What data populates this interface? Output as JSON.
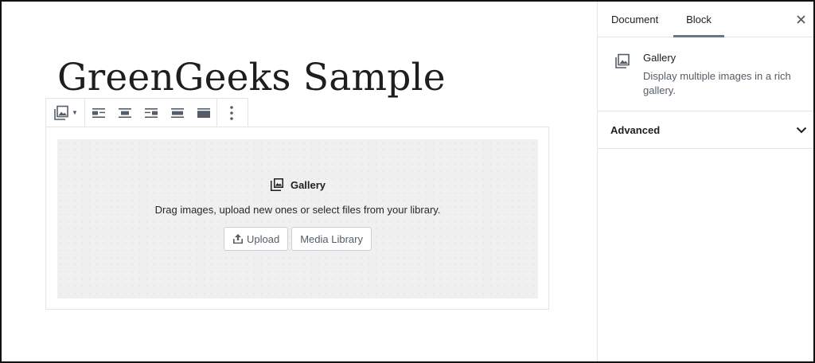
{
  "editor": {
    "post_title": "GreenGeeks Sample",
    "toolbar": {
      "block_type_icon": "gallery-icon",
      "alignments": [
        "align-left-icon",
        "align-center-icon",
        "align-right-icon",
        "align-wide-icon",
        "align-full-icon"
      ],
      "more_icon": "more-vertical-icon"
    },
    "gallery_placeholder": {
      "icon": "gallery-icon",
      "label": "Gallery",
      "instructions": "Drag images, upload new ones or select files from your library.",
      "upload_label": "Upload",
      "media_library_label": "Media Library"
    }
  },
  "sidebar": {
    "tabs": [
      {
        "label": "Document",
        "active": false
      },
      {
        "label": "Block",
        "active": true
      }
    ],
    "close_icon": "close-icon",
    "block_card": {
      "icon": "gallery-icon",
      "title": "Gallery",
      "description": "Display multiple images in a rich gallery."
    },
    "panels": [
      {
        "title": "Advanced",
        "expanded": false,
        "icon": "chevron-down-icon"
      }
    ]
  }
}
